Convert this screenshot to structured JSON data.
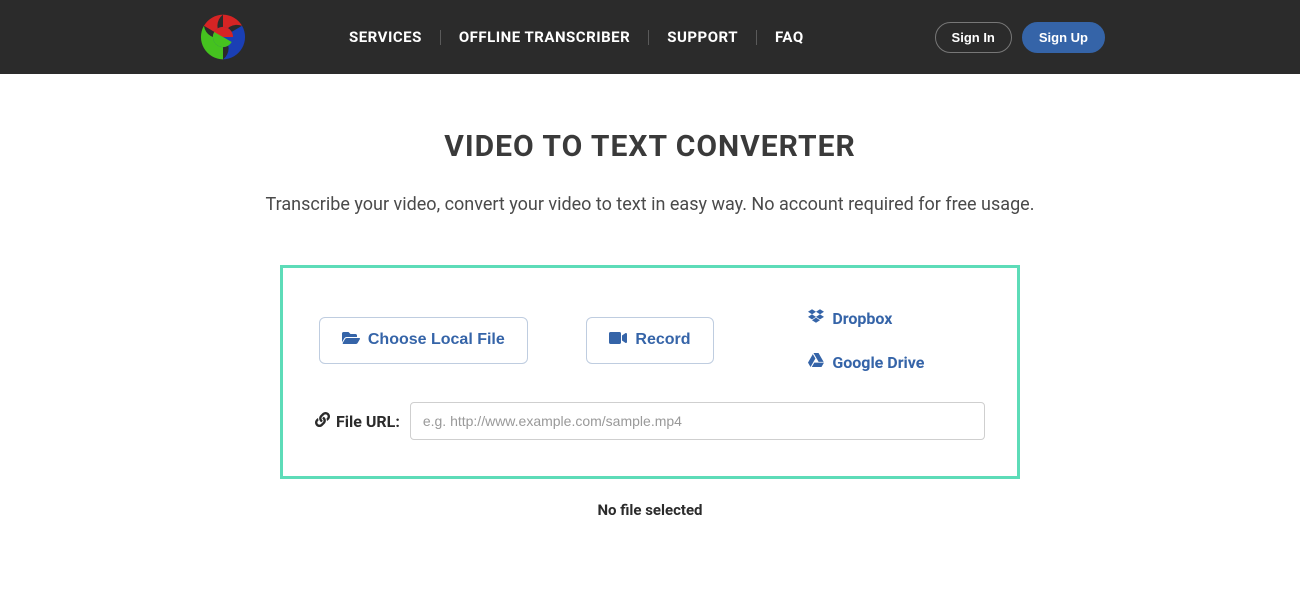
{
  "nav": {
    "links": [
      "SERVICES",
      "OFFLINE TRANSCRIBER",
      "SUPPORT",
      "FAQ"
    ],
    "signin": "Sign In",
    "signup": "Sign Up"
  },
  "page": {
    "title": "VIDEO TO TEXT CONVERTER",
    "subtitle": "Transcribe your video, convert your video to text in easy way. No account required for free usage."
  },
  "upload": {
    "choose_local": "Choose Local File",
    "record": "Record",
    "dropbox": "Dropbox",
    "google_drive": "Google Drive",
    "file_url_label": "File URL:",
    "file_url_placeholder": "e.g. http://www.example.com/sample.mp4",
    "file_url_value": "",
    "no_file": "No file selected"
  },
  "colors": {
    "nav_bg": "#2b2b2b",
    "accent_blue": "#3564a8",
    "box_border": "#5ddcb8"
  }
}
